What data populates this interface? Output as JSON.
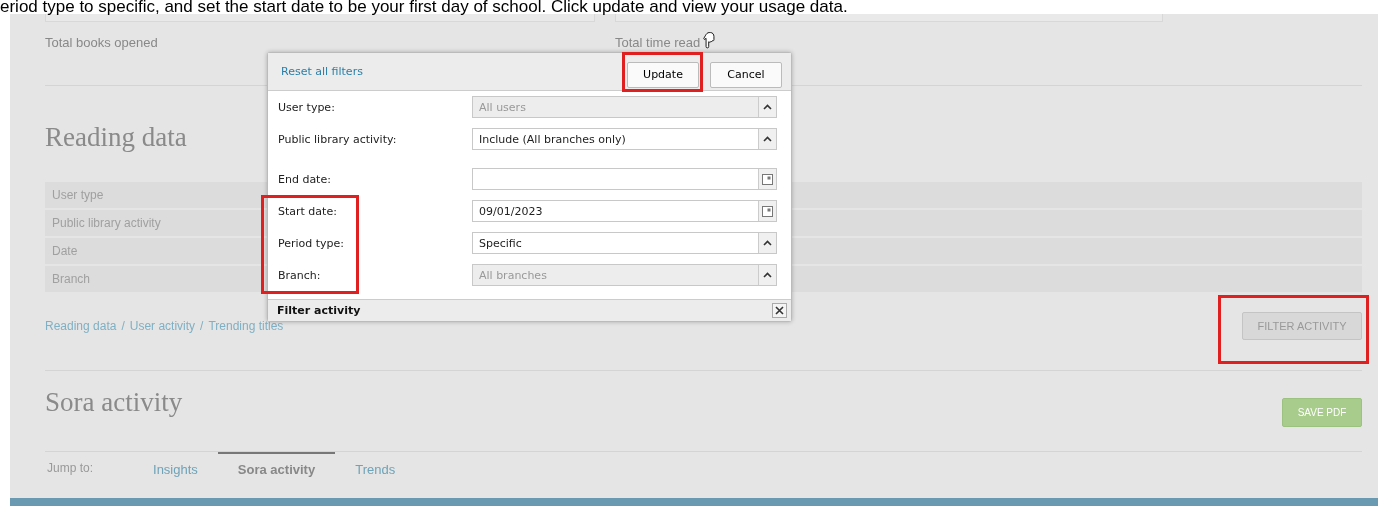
{
  "instruction": "eriod type to specific, and set the start date to be your first day of school. Click update and view your usage data.",
  "stats": [
    "Total books opened",
    "Total time read"
  ],
  "dialog": {
    "reset_link": "Reset all filters",
    "buttons": [
      {
        "label": "Update",
        "highlighted": true
      },
      {
        "label": "Cancel",
        "highlighted": false
      }
    ],
    "field_groups": [
      [
        {
          "label": "User type:",
          "kind": "select",
          "value": "All users",
          "disabled": true,
          "highlighted": false
        },
        {
          "label": "Public library activity:",
          "kind": "select",
          "value": "Include (All branches only)",
          "disabled": false,
          "highlighted": false
        }
      ],
      [
        {
          "label": "End date:",
          "kind": "date",
          "disabled": false,
          "highlighted": false
        },
        {
          "label": "Start date:",
          "kind": "date",
          "value": "09/01/2023",
          "disabled": false,
          "highlighted": true
        },
        {
          "label": "Period type:",
          "kind": "select",
          "value": "Specific",
          "disabled": false,
          "highlighted": true
        },
        {
          "label": "Branch:",
          "kind": "select",
          "value": "All branches",
          "disabled": true,
          "highlighted": true
        }
      ]
    ],
    "title": "Filter activity"
  },
  "reading_data": {
    "title": "Reading data",
    "filter_rows": [
      "User type",
      "Public library activity",
      "Date",
      "Branch"
    ],
    "breadcrumb": {
      "links": [
        "Reading data",
        "User activity",
        "Trending titles"
      ],
      "separator": "/"
    },
    "filter_button": {
      "label": "FILTER ACTIVITY",
      "highlighted": true
    }
  },
  "sora_activity": {
    "title": "Sora activity",
    "save_button": "SAVE PDF"
  },
  "jump_nav": {
    "label": "Jump to:",
    "tabs": [
      {
        "label": "Insights",
        "selected": false
      },
      {
        "label": "Sora activity",
        "selected": true
      },
      {
        "label": "Trends",
        "selected": false
      }
    ]
  }
}
